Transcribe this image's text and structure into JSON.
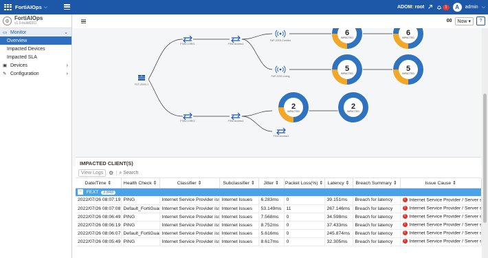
{
  "app": {
    "name": "FortiAIOps",
    "caret": "⌵",
    "sub_name": "FortiAIOps",
    "version": "v1.0-build0311"
  },
  "header": {
    "adom": "ADOM: root",
    "alert_count": "1",
    "user_initial": "A",
    "user_name": "admin",
    "user_caret": "⌵"
  },
  "toolbar": {
    "refresh": "00",
    "time_range": "Now ▾",
    "help": "?"
  },
  "sidebar": {
    "items": [
      {
        "icon": "monitor-icon",
        "label": "Monitor",
        "caret": "⌄",
        "head": true
      },
      {
        "label": "Overview",
        "sub": true,
        "active": true
      },
      {
        "label": "Impacted Devices",
        "sub": true
      },
      {
        "label": "Impacted SLA",
        "sub": true
      },
      {
        "icon": "devices-icon",
        "label": "Devices",
        "caret": "›"
      },
      {
        "icon": "wrench-icon",
        "label": "Configuration",
        "caret": "›"
      }
    ]
  },
  "topology": {
    "fortigate_label": "FGT-20XX-1",
    "switch_labels": [
      "FSW-CORE1",
      "FSW-Access1",
      "FSW-CORE2",
      "FSW-Access1",
      "FSW-Access1"
    ],
    "ap_labels": [
      "FAP-221E-Corridor",
      "FAP-221E-Living"
    ],
    "donut_sub": "IMPACTED",
    "donuts": [
      {
        "value": "6",
        "impacted_fraction": 0.25
      },
      {
        "value": "6",
        "impacted_fraction": 0.25
      },
      {
        "value": "5",
        "impacted_fraction": 0.25
      },
      {
        "value": "5",
        "impacted_fraction": 0.25
      },
      {
        "value": "2",
        "impacted_fraction": 0.25
      },
      {
        "value": "2",
        "impacted_fraction": 0.0
      }
    ],
    "colors": {
      "donut_main": "#2f73c0",
      "donut_impacted": "#f5a623"
    }
  },
  "panel": {
    "title": "IMPACTED CLIENT(S)",
    "view_logs": "View Logs",
    "search_placeholder": "Search",
    "columns": [
      "Date/Time ⇕",
      "Health Check ⇕",
      "Classifier ⇕",
      "Subclassifier ⇕",
      "Jitter ⇕",
      "Packet Loss(%) ⇕",
      "Latency ⇕",
      "Breach Summary ⇕",
      "Issue Cause ⇕"
    ],
    "group": {
      "toggle": "−",
      "label": "FEXT",
      "count": "3,848"
    },
    "rows": [
      [
        "2022/07/26 08:07:19",
        "PING",
        "Internet Service Provider issue",
        "Internet Issues",
        "6.283ms",
        "0",
        "39.151ms",
        "Breach for latency",
        "Internet Service Provider / Server side is"
      ],
      [
        "2022/07/26 08:07:08",
        "Default_FortiGuard",
        "Internet Service Provider issue",
        "Internet Issues",
        "53.149ms",
        "11",
        "267.146ms",
        "Breach for latency",
        "Internet Service Provider / Server side is"
      ],
      [
        "2022/07/26 08:06:49",
        "PING",
        "Internet Service Provider issue",
        "Internet Issues",
        "7.568ms",
        "0",
        "34.598ms",
        "Breach for latency",
        "Internet Service Provider / Server side is"
      ],
      [
        "2022/07/26 08:06:19",
        "PING",
        "Internet Service Provider issue",
        "Internet Issues",
        "8.752ms",
        "0",
        "37.433ms",
        "Breach for latency",
        "Internet Service Provider / Server side is"
      ],
      [
        "2022/07/26 08:06:07",
        "Default_FortiGuard",
        "Internet Service Provider issue",
        "Internet Issues",
        "5.616ms",
        "0",
        "245.874ms",
        "Breach for latency",
        "Internet Service Provider / Server side is"
      ],
      [
        "2022/07/26 08:05:49",
        "PING",
        "Internet Service Provider issue",
        "Internet Issues",
        "8.617ms",
        "0",
        "32.305ms",
        "Breach for latency",
        "Internet Service Provider / Server side is"
      ]
    ]
  }
}
